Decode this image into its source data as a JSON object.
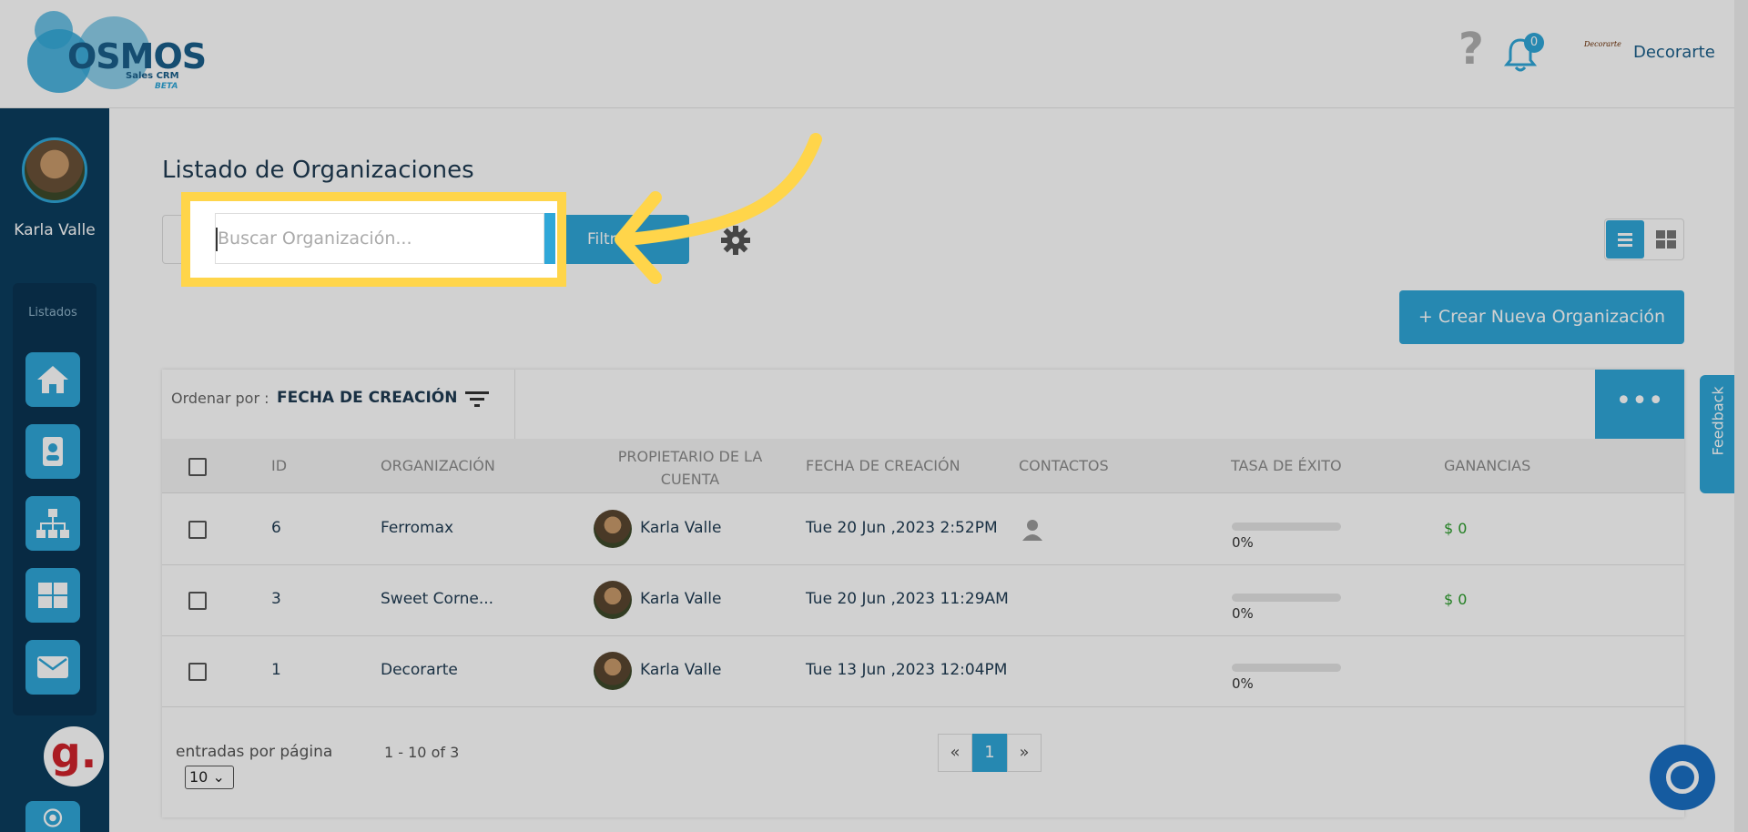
{
  "header": {
    "logo_text": "OSMOS",
    "logo_subtitle": "Sales CRM",
    "logo_badge": "BETA",
    "help_symbol": "?",
    "notification_count": "0",
    "company_logo_text": "Decorarte",
    "company_name": "Decorarte"
  },
  "sidebar": {
    "user_name": "Karla Valle",
    "section_label": "Listados",
    "items": [
      "home-icon",
      "contacts-icon",
      "organizations-icon",
      "dashboard-icon",
      "mail-icon"
    ],
    "g_badge": "g."
  },
  "main": {
    "title": "Listado de Organizaciones",
    "search_placeholder": "Buscar Organización...",
    "filter_label": "Filtrar",
    "create_button": "+ Crear Nueva Organización",
    "sort_label": "Ordenar por :",
    "sort_value": "FECHA DE CREACIÓN",
    "more_label": "•••"
  },
  "table": {
    "headers": {
      "id": "ID",
      "organization": "ORGANIZACIÓN",
      "owner": "PROPIETARIO DE LA CUENTA",
      "created": "FECHA DE CREACIÓN",
      "contacts": "CONTACTOS",
      "success_rate": "TASA DE ÉXITO",
      "earnings": "GANANCIAS"
    },
    "rows": [
      {
        "id": "6",
        "organization": "Ferromax",
        "owner": "Karla Valle",
        "created": "Tue 20 Jun ,2023 2:52PM",
        "success": "0%",
        "earnings": "$ 0"
      },
      {
        "id": "3",
        "organization": "Sweet Corne...",
        "owner": "Karla Valle",
        "created": "Tue 20 Jun ,2023 11:29AM",
        "success": "0%",
        "earnings": "$ 0"
      },
      {
        "id": "1",
        "organization": "Decorarte",
        "owner": "Karla Valle",
        "created": "Tue 13 Jun ,2023 12:04PM",
        "success": "0%",
        "earnings": ""
      }
    ]
  },
  "footer": {
    "per_page_label": "entradas por página",
    "per_page_value": "10",
    "range_text": "1 - 10 of 3",
    "prev": "«",
    "current_page": "1",
    "next": "»"
  },
  "feedback_label": "Feedback",
  "colors": {
    "accent": "#2fa7d8",
    "sidebar": "#0c3d5e",
    "highlight": "#ffd54a",
    "money": "#2a9c2a"
  }
}
